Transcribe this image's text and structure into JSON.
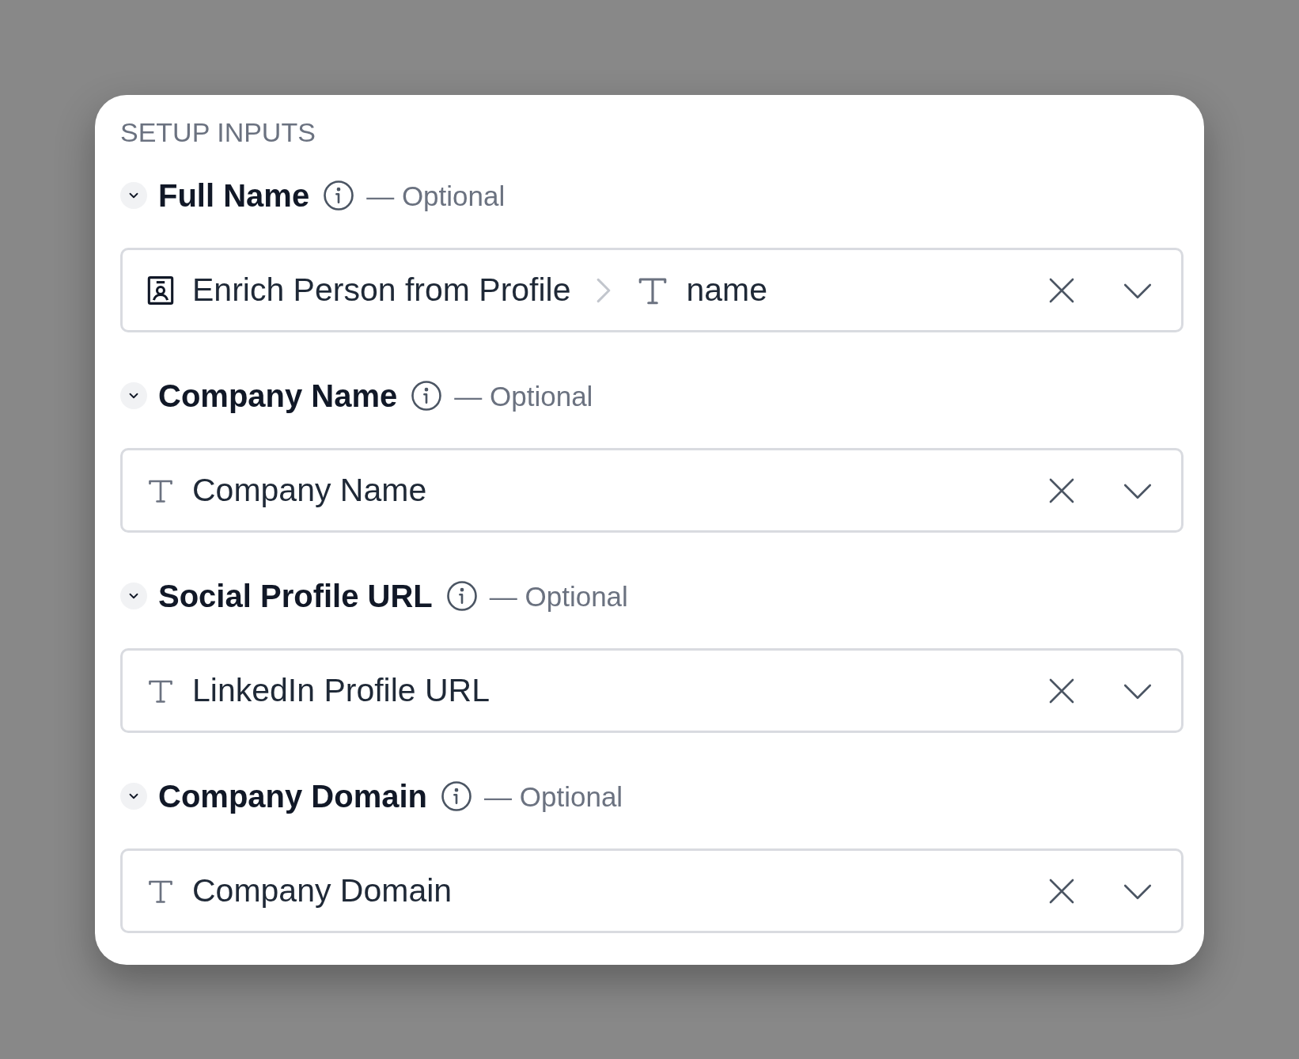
{
  "panel": {
    "title": "SETUP INPUTS"
  },
  "inputs": [
    {
      "label": "Full Name",
      "note": "— Optional",
      "expanded": true,
      "value": [
        {
          "kind": "source",
          "text": "Enrich Person from Profile"
        },
        {
          "kind": "field",
          "text": "name"
        }
      ]
    },
    {
      "label": "Company Name",
      "note": "— Optional",
      "expanded": true,
      "value": [
        {
          "kind": "text",
          "text": "Company Name"
        }
      ]
    },
    {
      "label": "Social Profile URL",
      "note": "— Optional",
      "expanded": true,
      "value": [
        {
          "kind": "text",
          "text": "LinkedIn Profile URL"
        }
      ]
    },
    {
      "label": "Company Domain",
      "note": "— Optional",
      "expanded": true,
      "value": [
        {
          "kind": "text",
          "text": "Company Domain"
        }
      ]
    }
  ]
}
